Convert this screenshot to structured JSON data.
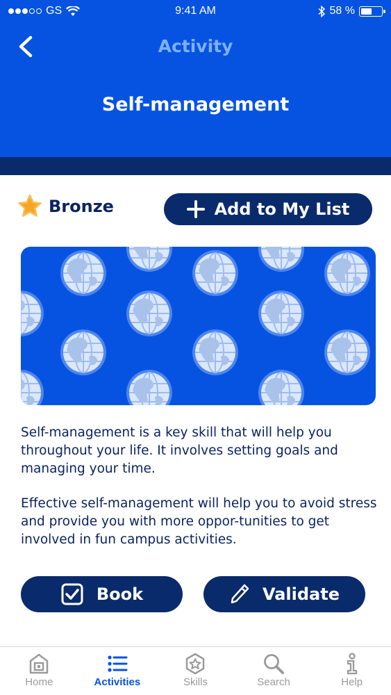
{
  "status_bar": {
    "carrier": "GS",
    "time": "9:41 AM",
    "battery": "58 %"
  },
  "header": {
    "nav_title": "Activity",
    "page_title": "Self-management"
  },
  "level": {
    "label": "Bronze",
    "icon": "star-icon"
  },
  "actions": {
    "add_label": "Add to My List",
    "book_label": "Book",
    "validate_label": "Validate"
  },
  "banner": {
    "pattern_icon": "globe-icon"
  },
  "description": {
    "paragraph_1": "Self-management is a key skill that will help you throughout your life. It involves setting goals and managing your time.",
    "paragraph_2": "Effective self-management will help you to avoid stress and provide you with more oppor-tunities to get involved in fun campus activities."
  },
  "tabs": [
    {
      "label": "Home",
      "icon": "home-icon",
      "active": false
    },
    {
      "label": "Activities",
      "icon": "list-icon",
      "active": true
    },
    {
      "label": "Skills",
      "icon": "badge-icon",
      "active": false
    },
    {
      "label": "Search",
      "icon": "search-icon",
      "active": false
    },
    {
      "label": "Help",
      "icon": "info-icon",
      "active": false
    }
  ],
  "colors": {
    "primary_blue": "#0653e1",
    "navy": "#0a2b6b",
    "nav_title": "#7fb0ff",
    "star": "#f5a623"
  }
}
